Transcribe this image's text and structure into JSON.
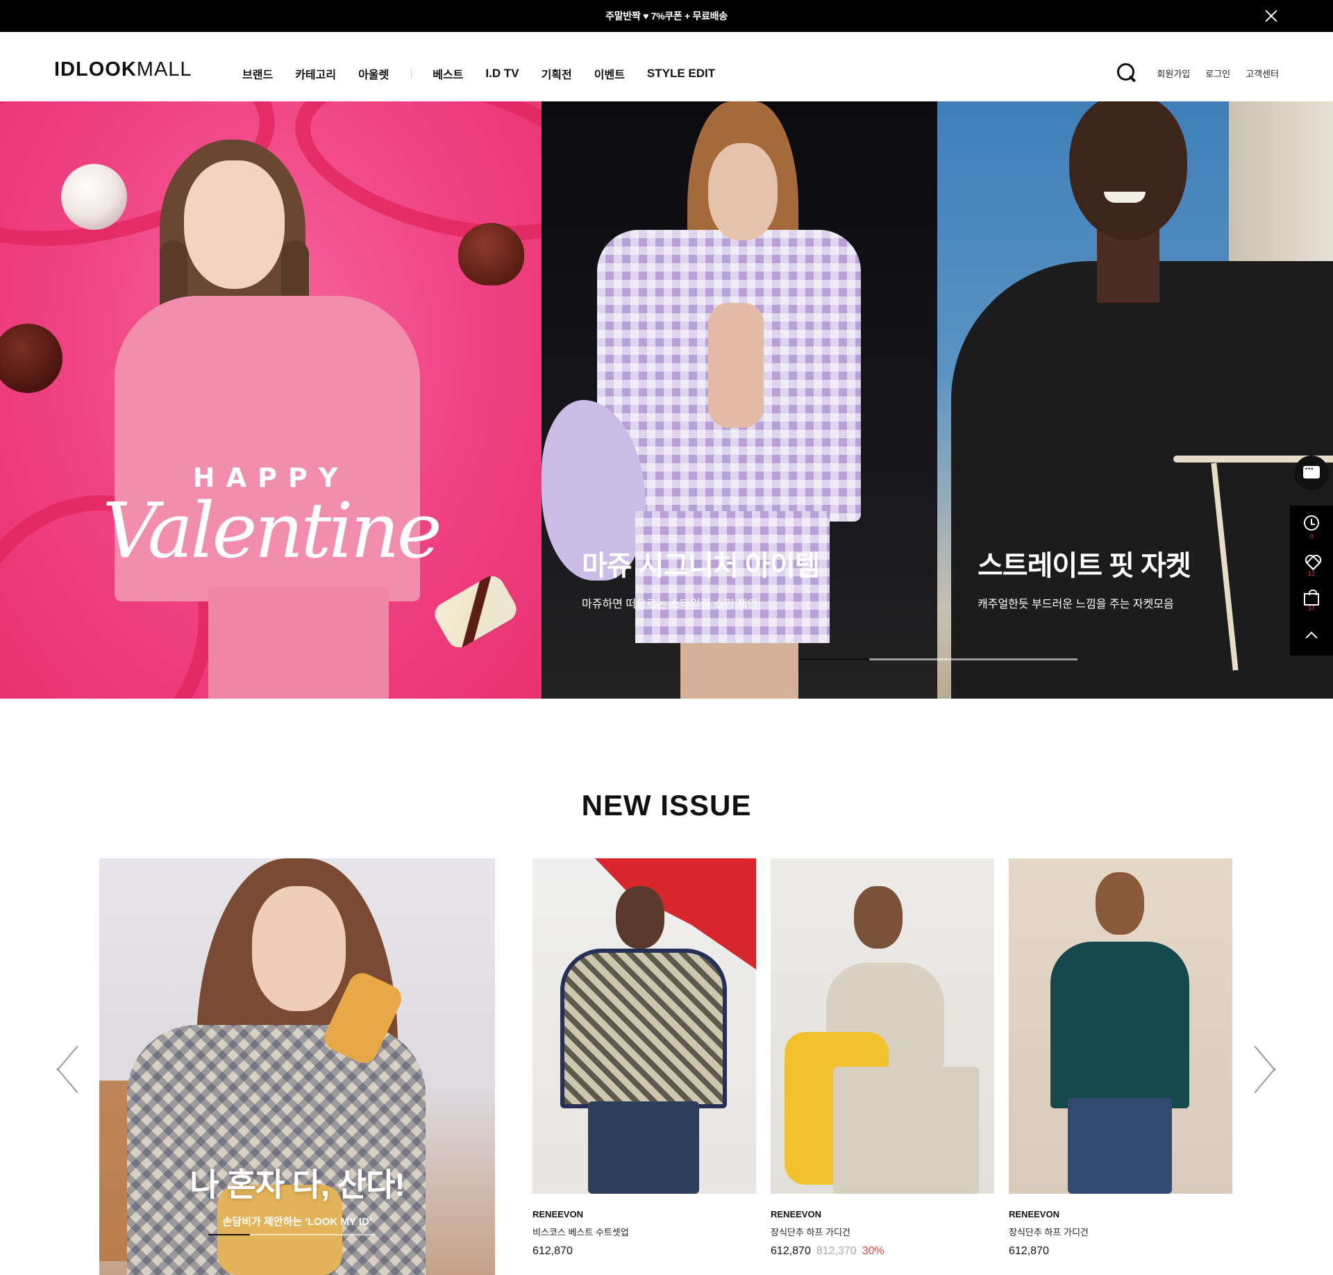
{
  "topbar": {
    "message": "주말반짝 ♥ 7%쿠폰 + 무료배송"
  },
  "header": {
    "logo_bold": "IDLOOK",
    "logo_light": "MALL",
    "nav": [
      "브랜드",
      "카테고리",
      "아울렛",
      "베스트",
      "I.D TV",
      "기획전",
      "이벤트",
      "STYLE EDIT"
    ],
    "util": [
      "회원가입",
      "로그인",
      "고객센터"
    ]
  },
  "hero": {
    "panel1": {
      "happy": "HAPPY",
      "valentine": "Valentine"
    },
    "panel2": {
      "title": "마쥬 시그니처 아이템",
      "subtitle": "마쥬하면 떠오르는 스타일링 쇼핑 제안"
    },
    "panel3": {
      "title": "스트레이트 핏 자켓",
      "subtitle": "캐주얼한듯 부드러운 느낌을 주는 자켓모음"
    },
    "progress": 0.25
  },
  "quick_menu": {
    "recent_count": "0",
    "wish_count": "12",
    "cart_count": "37"
  },
  "new_issue": {
    "title": "NEW ISSUE",
    "feature": {
      "title": "나 혼자 다, 산다!",
      "subtitle": "손담비가 제안하는 'LOOK MY ID'",
      "progress": 0.25
    },
    "products": [
      {
        "brand": "RENEEVON",
        "name": "비스코스 베스트 수트셋업",
        "price": "612,870",
        "original_price": "",
        "discount": ""
      },
      {
        "brand": "RENEEVON",
        "name": "장식단추 하프 가디건",
        "price": "612,870",
        "original_price": "812,370",
        "discount": "30%"
      },
      {
        "brand": "RENEEVON",
        "name": "장식단추 하프 가디건",
        "price": "612,870",
        "original_price": "",
        "discount": ""
      }
    ]
  },
  "colors": {
    "accent_pink": "#ef3f80",
    "discount_red": "#e84848",
    "black": "#000000"
  }
}
